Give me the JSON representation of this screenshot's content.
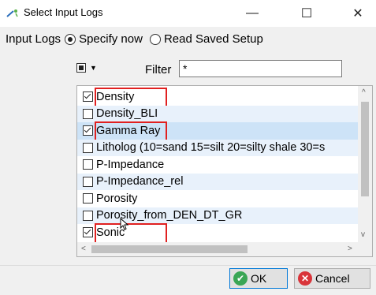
{
  "window": {
    "title": "Select Input Logs",
    "minimize_glyph": "—",
    "maximize_glyph": "☐",
    "close_glyph": "✕"
  },
  "mode": {
    "label": "Input Logs",
    "options": [
      {
        "label": "Specify now",
        "selected": true
      },
      {
        "label": "Read Saved Setup",
        "selected": false
      }
    ]
  },
  "filter": {
    "label": "Filter",
    "value": "*"
  },
  "logs": [
    {
      "label": "Density",
      "checked": true,
      "highlighted": true
    },
    {
      "label": "Density_BLI",
      "checked": false
    },
    {
      "label": "Gamma Ray",
      "checked": true,
      "highlighted": true
    },
    {
      "label": "Litholog (10=sand 15=silt 20=silty shale 30=s",
      "checked": false
    },
    {
      "label": "P-Impedance",
      "checked": false
    },
    {
      "label": "P-Impedance_rel",
      "checked": false
    },
    {
      "label": "Porosity",
      "checked": false
    },
    {
      "label": "Porosity_from_DEN_DT_GR",
      "checked": false
    },
    {
      "label": "Sonic",
      "checked": true,
      "highlighted": true
    }
  ],
  "buttons": {
    "ok": "OK",
    "cancel": "Cancel"
  },
  "icons": {
    "app": "wand-icon",
    "ok": "check-circle-icon",
    "cancel": "x-circle-icon",
    "cursor": "mouse-pointer-icon"
  },
  "colors": {
    "highlight_box": "#e02020",
    "selected_row": "#cde3f7",
    "alt_row": "#e8f1fb",
    "ok_icon": "#3aa655",
    "cancel_icon": "#d9343a"
  }
}
